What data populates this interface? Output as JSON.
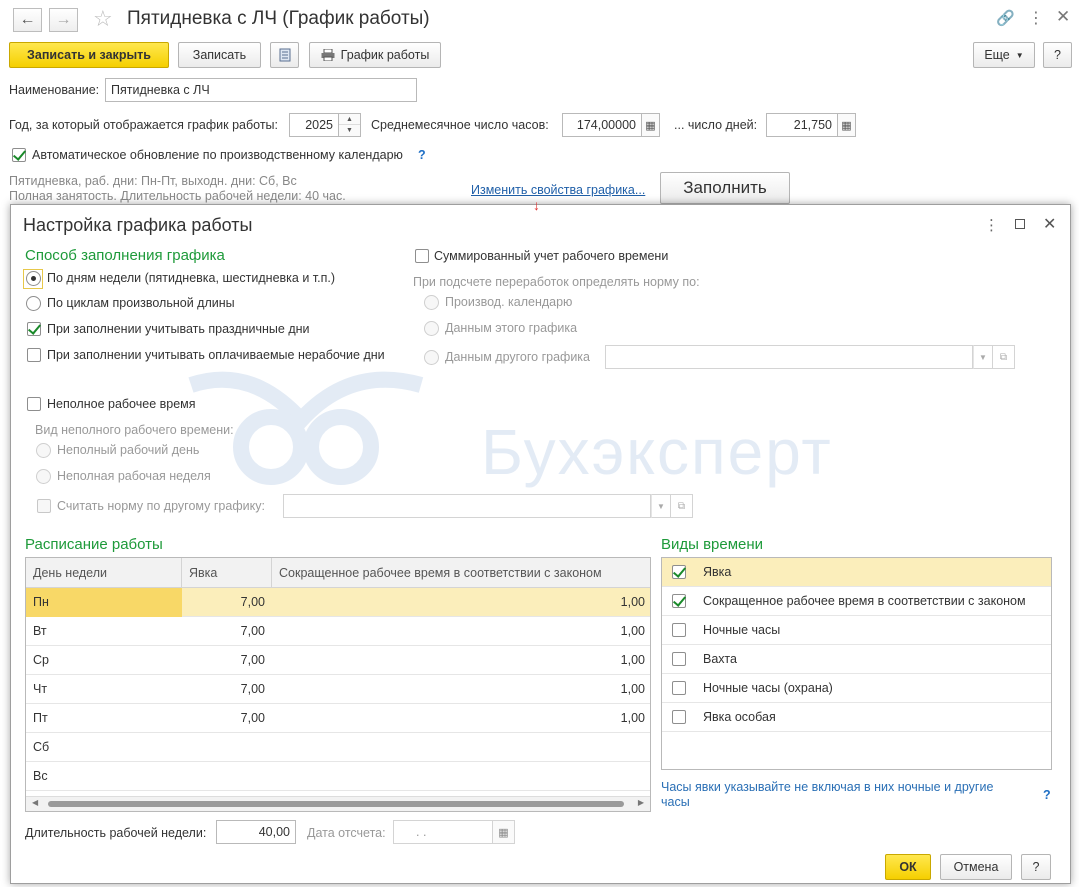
{
  "window": {
    "title": "Пятидневка с ЛЧ (График работы)",
    "btn_save_close": "Записать и закрыть",
    "btn_save": "Записать",
    "btn_schedule": "График работы",
    "btn_more": "Еще",
    "btn_help": "?"
  },
  "form": {
    "name_label": "Наименование:",
    "name_value": "Пятидневка с ЛЧ",
    "year_label": "Год, за который отображается график работы:",
    "year_value": "2025",
    "avg_hours_label": "Среднемесячное число часов:",
    "avg_hours_value": "174,00000",
    "days_label": "... число дней:",
    "days_value": "21,750",
    "auto_update_label": "Автоматическое обновление по производственному календарю",
    "auto_update_help": "?",
    "summary_line1": "Пятидневка, раб. дни: Пн-Пт, выходн. дни: Сб, Вс",
    "summary_line2": "Полная занятость. Длительность рабочей недели: 40 час.",
    "change_props_link": "Изменить свойства графика...",
    "fill_button": "Заполнить"
  },
  "dialog": {
    "title": "Настройка графика работы",
    "fill_method_heading": "Способ заполнения графика",
    "opt_by_weekdays": "По дням недели (пятидневка, шестидневка и т.п.)",
    "opt_by_cycles": "По циклам произвольной длины",
    "chk_holidays": "При заполнении учитывать праздничные дни",
    "chk_paid_nonwork": "При заполнении учитывать оплачиваемые нерабочие дни",
    "chk_summarized": "Суммированный учет рабочего времени",
    "overtime_norm_label": "При подсчете переработок определять норму по:",
    "opt_prod_calendar": "Производ. календарю",
    "opt_this_schedule": "Данным этого графика",
    "opt_other_schedule": "Данным другого графика",
    "chk_part_time": "Неполное рабочее время",
    "part_time_kind_label": "Вид неполного рабочего времени:",
    "opt_part_day": "Неполный рабочий день",
    "opt_part_week": "Неполная рабочая неделя",
    "chk_norm_other": "Считать норму по другому графику:",
    "schedule_heading": "Расписание работы",
    "col_day": "День недели",
    "col_attendance": "Явка",
    "col_reduced": "Сокращенное рабочее время в соответствии с законом",
    "rows": [
      {
        "day": "Пн",
        "att": "7,00",
        "red": "1,00"
      },
      {
        "day": "Вт",
        "att": "7,00",
        "red": "1,00"
      },
      {
        "day": "Ср",
        "att": "7,00",
        "red": "1,00"
      },
      {
        "day": "Чт",
        "att": "7,00",
        "red": "1,00"
      },
      {
        "day": "Пт",
        "att": "7,00",
        "red": "1,00"
      },
      {
        "day": "Сб",
        "att": "",
        "red": ""
      },
      {
        "day": "Вс",
        "att": "",
        "red": ""
      }
    ],
    "time_types_heading": "Виды времени",
    "time_types": [
      {
        "label": "Явка",
        "checked": true
      },
      {
        "label": "Сокращенное рабочее время в соответствии с законом",
        "checked": true
      },
      {
        "label": "Ночные часы",
        "checked": false
      },
      {
        "label": "Вахта",
        "checked": false
      },
      {
        "label": "Ночные часы (охрана)",
        "checked": false
      },
      {
        "label": "Явка особая",
        "checked": false
      }
    ],
    "hint_text": "Часы явки указывайте не включая в них ночные и другие часы",
    "hint_help": "?",
    "week_length_label": "Длительность рабочей недели:",
    "week_length_value": "40,00",
    "ref_date_label": "Дата отсчета:",
    "ref_date_value": ". .",
    "btn_ok": "ОК",
    "btn_cancel": "Отмена",
    "btn_help": "?",
    "watermark": "Бухэксперт"
  }
}
